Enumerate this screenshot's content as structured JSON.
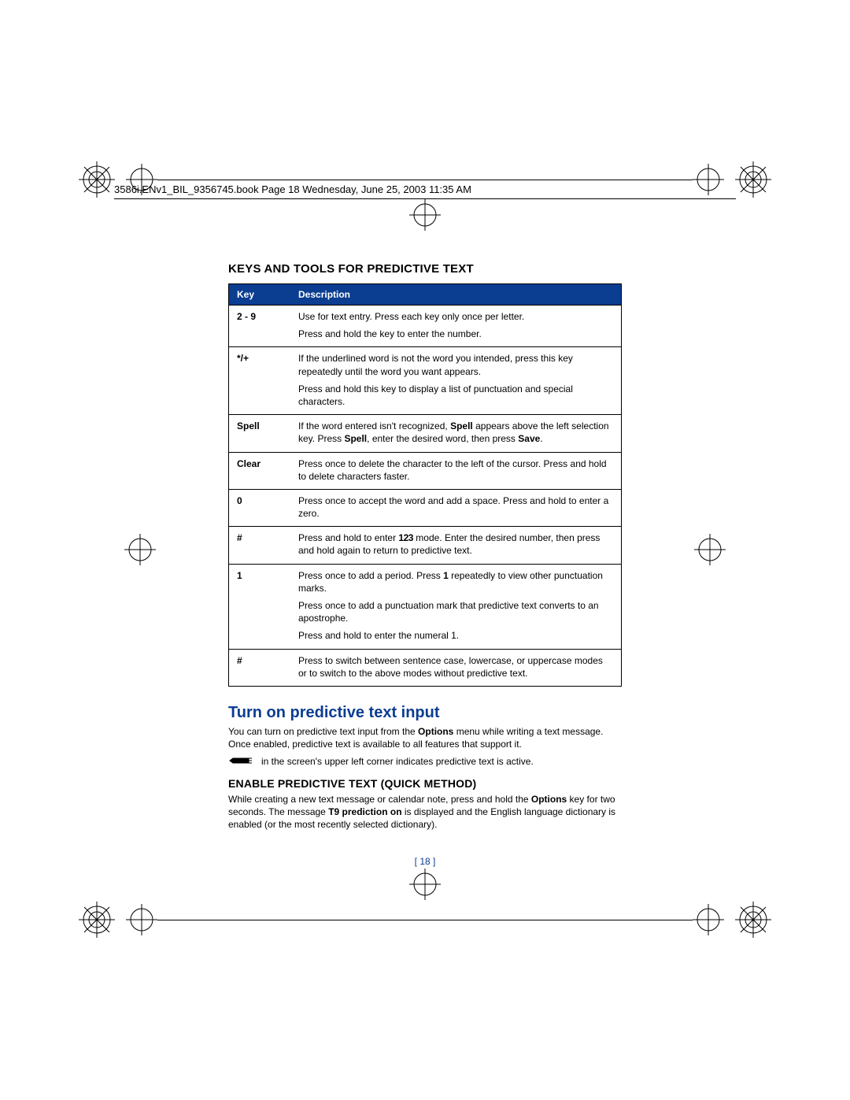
{
  "header": "3586i.ENv1_BIL_9356745.book  Page 18  Wednesday, June 25, 2003  11:35 AM",
  "section_heading": "KEYS AND TOOLS FOR PREDICTIVE TEXT",
  "table": {
    "head_key": "Key",
    "head_desc": "Description",
    "rows": [
      {
        "key": "2 - 9",
        "desc": [
          "Use for text entry. Press each key only once per letter.",
          "Press and hold the key to enter the number."
        ]
      },
      {
        "key": "*/+",
        "desc": [
          "If the underlined word is not the word you intended, press this key repeatedly until the word you want appears.",
          "Press and hold this key to display a list of punctuation and special characters."
        ]
      },
      {
        "key": "Spell",
        "desc_rich": {
          "pre": "If the word entered isn't recognized, ",
          "b1": "Spell",
          "mid": " appears above the left selection key. Press ",
          "b2": "Spell",
          "mid2": ", enter the desired word, then press ",
          "b3": "Save",
          "post": "."
        }
      },
      {
        "key": "Clear",
        "desc": [
          "Press once to delete the character to the left of the cursor. Press and hold to delete characters faster."
        ]
      },
      {
        "key": "0",
        "desc": [
          "Press once to accept the word and add a space. Press and hold to enter a zero."
        ]
      },
      {
        "key": "#",
        "desc_rich2": {
          "pre": "Press and hold to enter ",
          "mode": "123",
          "post": " mode. Enter the desired number, then press and hold again to return to predictive text."
        }
      },
      {
        "key": "1",
        "desc_rich3": {
          "line1_pre": "Press once to add a period. Press ",
          "line1_b": "1",
          "line1_post": " repeatedly to view other punctuation marks.",
          "line2": "Press once to add a punctuation mark that predictive text converts to an apostrophe.",
          "line3": "Press and hold to enter the numeral 1."
        }
      },
      {
        "key": "#",
        "desc": [
          "Press to switch between sentence case, lowercase, or uppercase modes or to switch to the above modes without predictive text."
        ]
      }
    ]
  },
  "blue_heading": "Turn on predictive text input",
  "para1": {
    "pre": "You can turn on predictive text input from the ",
    "b": "Options",
    "post": " menu while writing a text message. Once enabled, predictive text is available to all features that support it."
  },
  "icon_line": "in the screen's upper left corner indicates predictive text is active.",
  "sub_heading": "ENABLE PREDICTIVE TEXT (QUICK METHOD)",
  "para2": {
    "pre": "While creating a new text message or calendar note, press and hold the ",
    "b1": "Options",
    "mid": " key for two seconds. The message ",
    "b2": "T9 prediction on",
    "post": " is displayed and the English language dictionary is enabled (or the most recently selected dictionary)."
  },
  "page_number": "[ 18 ]"
}
